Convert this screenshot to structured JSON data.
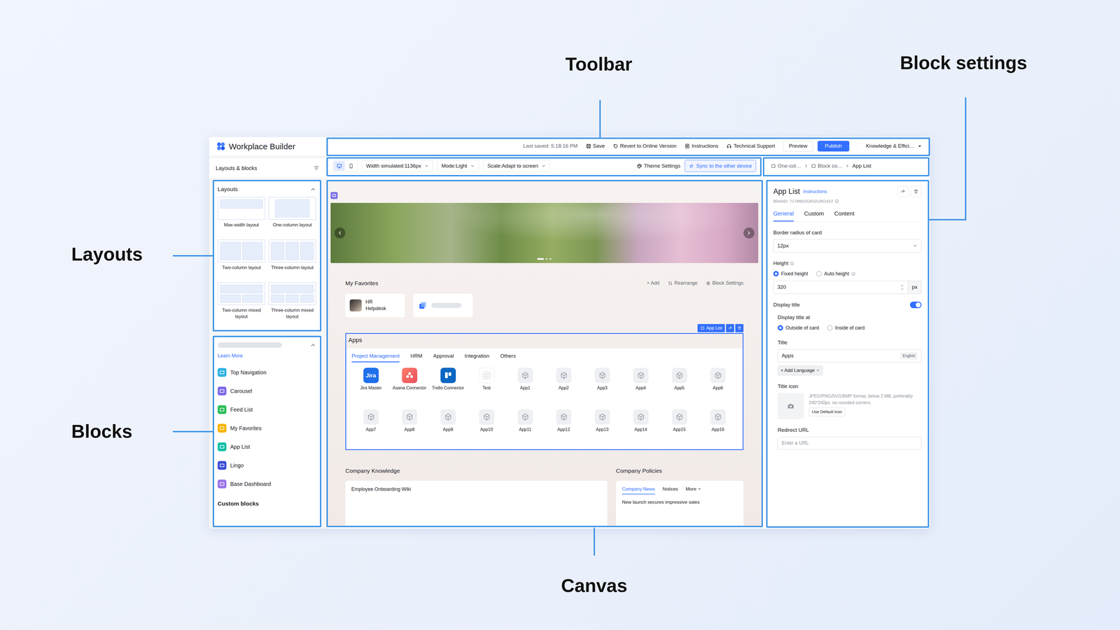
{
  "annotations": {
    "toolbar": "Toolbar",
    "block_settings": "Block settings",
    "layouts": "Layouts",
    "blocks": "Blocks",
    "canvas": "Canvas"
  },
  "app": {
    "title": "Workplace Builder"
  },
  "header": {
    "last_saved": "Last saved: 5:18:16 PM",
    "actions": [
      "Save",
      "Revert to Online Version",
      "Instructions",
      "Technical Support"
    ],
    "preview": "Preview",
    "publish": "Publish",
    "workspace": "Knowledge & Effici…"
  },
  "sidebar": {
    "heading": "Layouts & blocks",
    "layouts": {
      "title": "Layouts",
      "expanded": true,
      "items": [
        {
          "label": "Max-width layout",
          "kind": "max"
        },
        {
          "label": "One-column layout",
          "kind": "one"
        },
        {
          "label": "Two-column layout",
          "kind": "two"
        },
        {
          "label": "Three-column layout",
          "kind": "three"
        },
        {
          "label": "Two-column mixed layout",
          "kind": "twomixed"
        },
        {
          "label": "Three-column mixed layout",
          "kind": "threemixed"
        }
      ]
    },
    "blocks": {
      "expanded": true,
      "learn_more": "Learn More",
      "items": [
        {
          "label": "Top Navigation",
          "color": "#2fb3e3"
        },
        {
          "label": "Carousel",
          "color": "#7c6ce6"
        },
        {
          "label": "Feed List",
          "color": "#2fbe5a"
        },
        {
          "label": "My Favorites",
          "color": "#f7b500"
        },
        {
          "label": "App List",
          "color": "#14c0a8"
        },
        {
          "label": "Lingo",
          "color": "#3d4fd6"
        },
        {
          "label": "Base Dashboard",
          "color": "#9b74e8"
        }
      ],
      "custom_title": "Custom blocks"
    }
  },
  "toolbar": {
    "devices": [
      {
        "kind": "desktop",
        "selected": true
      },
      {
        "kind": "mobile",
        "selected": false
      }
    ],
    "selects": [
      "Width simulated:1136px",
      "Mode:Light",
      "Scale:Adapt to screen"
    ],
    "theme": "Theme Settings",
    "sync": "Sync to the other device"
  },
  "breadcrumb": [
    "One-col…",
    "Block co…",
    "App List"
  ],
  "canvas": {
    "carousel": {
      "dots": [
        {
          "selected": true
        },
        {
          "selected": false
        },
        {
          "selected": false
        }
      ]
    },
    "favorites": {
      "title": "My Favorites",
      "actions": [
        "+ Add",
        "Rearrange",
        "Block Settings"
      ],
      "items": [
        {
          "kind": "app",
          "label": "HR Helpdesk"
        },
        {
          "kind": "skeleton"
        }
      ]
    },
    "apps": {
      "title": "Apps",
      "tag": "App List",
      "selected": true,
      "tabs": [
        {
          "label": "Project Management",
          "selected": true
        },
        {
          "label": "HRM",
          "selected": false
        },
        {
          "label": "Approval",
          "selected": false
        },
        {
          "label": "Integration",
          "selected": false
        },
        {
          "label": "Others",
          "selected": false
        }
      ],
      "items": [
        {
          "label": "Jira Master",
          "kind": "jira",
          "icon_text": "Jira"
        },
        {
          "label": "Asana Connector",
          "kind": "asana"
        },
        {
          "label": "Trello Connector",
          "kind": "trello"
        },
        {
          "label": "Test",
          "kind": "test"
        },
        {
          "label": "App1",
          "kind": "placeholder"
        },
        {
          "label": "App2",
          "kind": "placeholder"
        },
        {
          "label": "App3",
          "kind": "placeholder"
        },
        {
          "label": "App4",
          "kind": "placeholder"
        },
        {
          "label": "App5",
          "kind": "placeholder"
        },
        {
          "label": "App6",
          "kind": "placeholder"
        },
        {
          "label": "App7",
          "kind": "placeholder"
        },
        {
          "label": "App8",
          "kind": "placeholder"
        },
        {
          "label": "App9",
          "kind": "placeholder"
        },
        {
          "label": "App10",
          "kind": "placeholder"
        },
        {
          "label": "App11",
          "kind": "placeholder"
        },
        {
          "label": "App12",
          "kind": "placeholder"
        },
        {
          "label": "App13",
          "kind": "placeholder"
        },
        {
          "label": "App14",
          "kind": "placeholder"
        },
        {
          "label": "App15",
          "kind": "placeholder"
        },
        {
          "label": "App16",
          "kind": "placeholder"
        }
      ]
    },
    "knowledge": {
      "title": "Company Knowledge",
      "items": [
        "Employee Onboarding Wiki"
      ]
    },
    "policies": {
      "title": "Company Policies",
      "tabs": [
        {
          "label": "Company News",
          "selected": true,
          "kind": "tab"
        },
        {
          "label": "Notices",
          "selected": false,
          "kind": "tab"
        },
        {
          "label": "More",
          "selected": false,
          "kind": "menu"
        }
      ],
      "items": [
        "New launch secures impressive sales"
      ]
    }
  },
  "settings": {
    "title": "App List",
    "instructions": "Instructions",
    "block_id": "BlockID: 7178662526321852422",
    "tabs": [
      {
        "label": "General",
        "selected": true
      },
      {
        "label": "Custom",
        "selected": false
      },
      {
        "label": "Content",
        "selected": false
      }
    ],
    "border_radius": {
      "label": "Border radius of card",
      "value": "12px"
    },
    "height": {
      "label": "Height",
      "options": [
        {
          "label": "Fixed height",
          "selected": true
        },
        {
          "label": "Auto height",
          "selected": false
        }
      ],
      "value": "320",
      "unit": "px"
    },
    "display_title": {
      "label": "Display title",
      "on": true
    },
    "title_position": {
      "label": "Display title at",
      "options": [
        {
          "label": "Outside of card",
          "selected": true
        },
        {
          "label": "Inside of card",
          "selected": false
        }
      ]
    },
    "title_field": {
      "label": "Title",
      "value": "Apps",
      "language": "English",
      "add_language": "+ Add Language"
    },
    "title_icon": {
      "label": "Title icon",
      "hint": "JPEG/PNG/SVG/BMP format, below 2 MB, preferably 240*240px, no rounded corners.",
      "button": "Use Default Icon"
    },
    "redirect": {
      "label": "Redirect URL",
      "placeholder": "Enter a URL"
    }
  }
}
